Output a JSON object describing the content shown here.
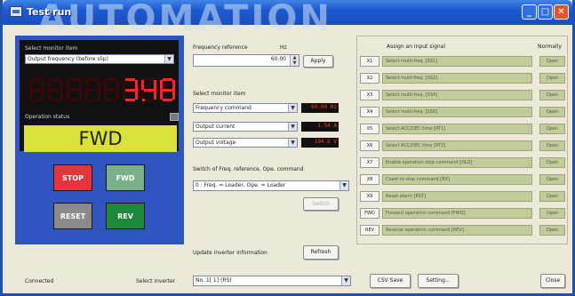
{
  "window": {
    "title": "Test run",
    "watermark": "AUTOMATION"
  },
  "title_buttons": {
    "minimize": "_",
    "maximize": "□",
    "close": "✕"
  },
  "left_panel": {
    "select_label": "Select monitor item",
    "monitor_select": "Output frequency (before slip)",
    "segment_display": "3.48",
    "segment_digits": [
      "",
      "",
      "",
      "",
      "",
      "3",
      "4",
      "8"
    ],
    "status_label": "Operation status",
    "status_indicator": "",
    "status_value": "FWD",
    "buttons": {
      "stop": "STOP",
      "fwd": "FWD",
      "reset": "RESET",
      "rev": "REV"
    },
    "colors": {
      "stop": "#e4343c",
      "fwd": "#7ab08a",
      "reset": "#8a8a8a",
      "rev": "#1b8a3a",
      "status_bg": "#d9e23a"
    }
  },
  "middle_panel": {
    "freq_ref_label": "Frequency reference",
    "freq_unit": "Hz",
    "freq_value": "60.00",
    "apply_button": "Apply",
    "monitor_items_label": "Select monitor item",
    "monitor_items": [
      {
        "name": "Frequency command",
        "value": "60.00 Hz"
      },
      {
        "name": "Output current",
        "value": "1.54 A"
      },
      {
        "name": "Output voltage",
        "value": "194.6 V"
      }
    ],
    "switch_label": "Switch of Freq. reference, Ope. command",
    "switch_value": "0 : Freq. = Loader,  Ope. = Loader",
    "disabled_button": "Switch",
    "update_label": "Update inverter information",
    "refresh_button": "Refresh"
  },
  "right_panel": {
    "header_assign": "Assign an input signal",
    "header_normally": "Normally",
    "rows": [
      {
        "code": "X1",
        "signal": "Select multi-freq. [SS1]",
        "state": "Open"
      },
      {
        "code": "X2",
        "signal": "Select multi-freq. [SS2]",
        "state": "Open"
      },
      {
        "code": "X3",
        "signal": "Select multi-freq. [SS4]",
        "state": "Open"
      },
      {
        "code": "X4",
        "signal": "Select multi-freq. [SS8]",
        "state": "Open"
      },
      {
        "code": "X5",
        "signal": "Select ACC/DEC time [RT1]",
        "state": "Open"
      },
      {
        "code": "X6",
        "signal": "Select ACC/DEC time [RT2]",
        "state": "Open"
      },
      {
        "code": "X7",
        "signal": "Enable operation stop command [HLD]",
        "state": "Open"
      },
      {
        "code": "X8",
        "signal": "Coast to stop command [BX]",
        "state": "Open"
      },
      {
        "code": "X9",
        "signal": "Reset alarm [RST]",
        "state": "Open"
      },
      {
        "code": "FWD",
        "signal": "Forward operation command [FWD]",
        "state": "Open"
      },
      {
        "code": "REV",
        "signal": "Reverse operation command [REV]",
        "state": "Open"
      }
    ]
  },
  "bottom_bar": {
    "status": "Connected",
    "select_inverter_label": "Select inverter",
    "inverter_value": "No. 1[ 1] (RS)",
    "csv_button": "CSV Save",
    "setting_button": "Setting...",
    "close_button": "Close"
  }
}
